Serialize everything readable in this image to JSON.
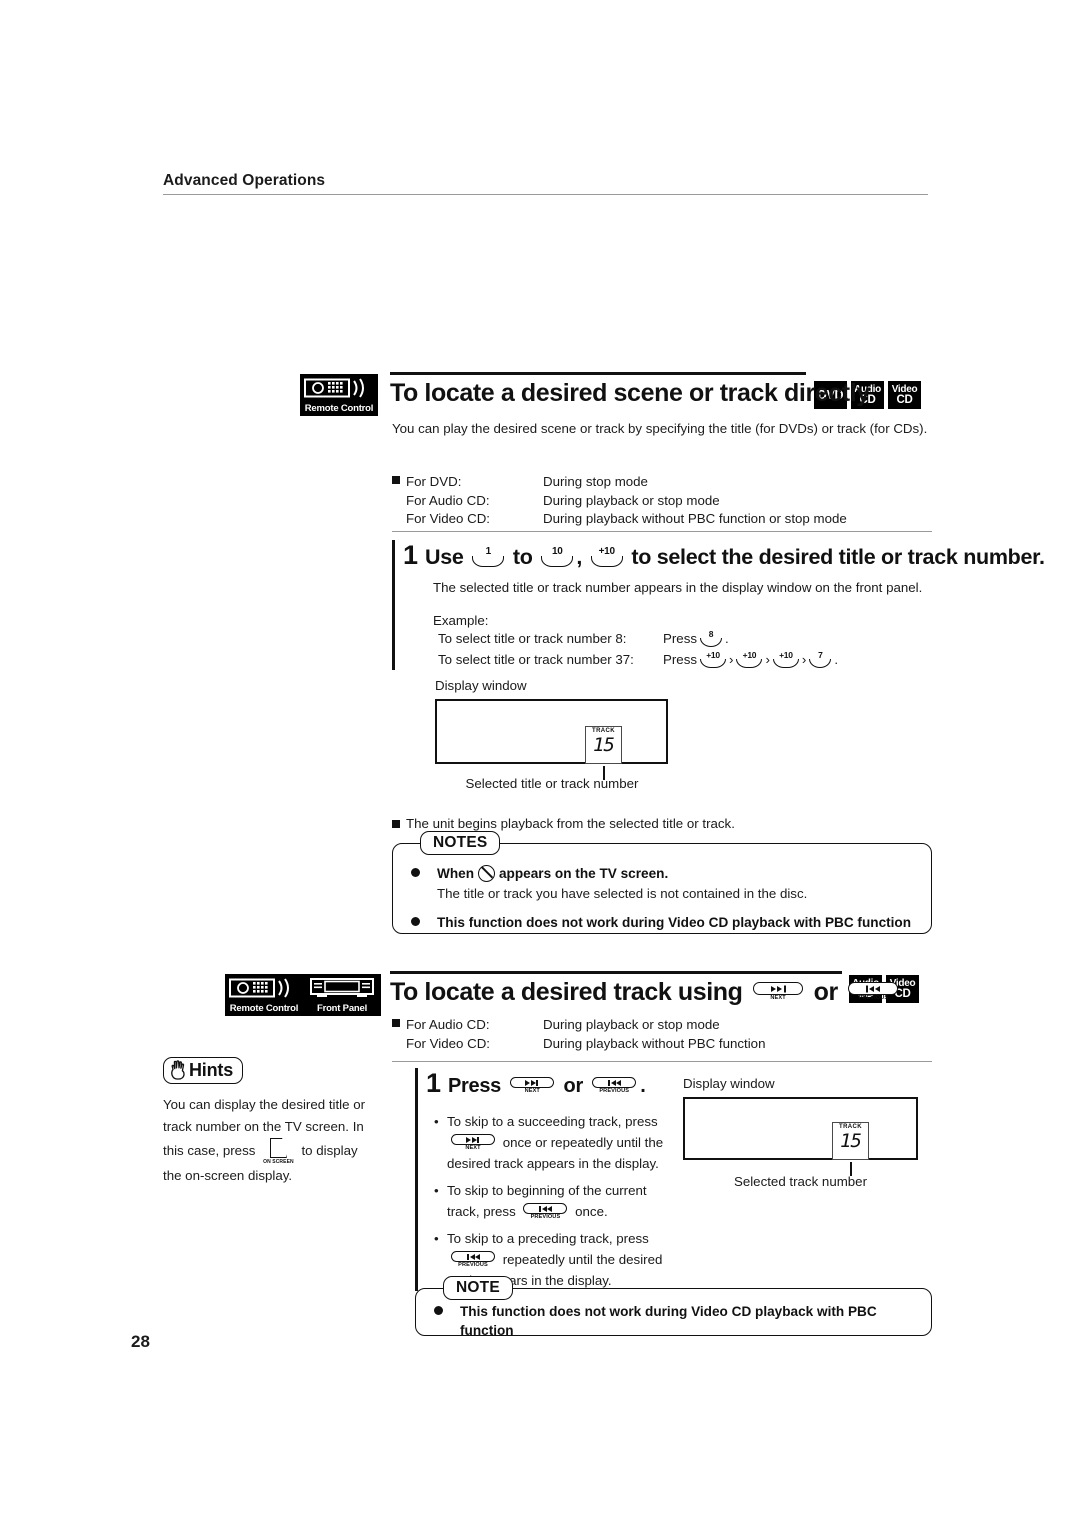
{
  "running_head": {
    "text": "Advanced Operations"
  },
  "page_number": "28",
  "section1": {
    "source_badge": {
      "label": "Remote Control",
      "icon": "remote-control-icon"
    },
    "title": "To locate a desired scene or track directly",
    "media_badges": [
      {
        "line1": "DVD",
        "line2": ""
      },
      {
        "line1": "Audio",
        "line2": "CD"
      },
      {
        "line1": "Video",
        "line2": "CD"
      }
    ],
    "intro": "You can play the desired scene or track by specifying the title (for DVDs) or track (for CDs).",
    "modes": [
      {
        "key": "For DVD:",
        "value": "During stop mode"
      },
      {
        "key": "For Audio CD:",
        "value": "During playback or stop mode"
      },
      {
        "key": "For Video CD:",
        "value": "During playback without PBC function or stop mode"
      }
    ],
    "step": {
      "number": "1",
      "title_before": "Use",
      "key_1": "1",
      "title_mid1": "to",
      "key_10": "10",
      "title_comma": ",",
      "key_plus10": "+10",
      "title_after": "to select the desired title or track number.",
      "description": "The selected title or track number appears in the display window on the front panel.",
      "example_label": "Example:",
      "examples": [
        {
          "description": "To select title or track number 8:",
          "press_label": "Press",
          "keys": [
            "8"
          ],
          "separators": [],
          "period": "."
        },
        {
          "description": "To select title or track number 37:",
          "press_label": "Press",
          "keys": [
            "+10",
            "+10",
            "+10",
            "7"
          ],
          "separators": [
            "›",
            "›",
            "›"
          ],
          "period": "."
        }
      ]
    },
    "display_figure": {
      "caption_top": "Display window",
      "track_label": "TRACK",
      "digits": "15",
      "caption_bottom": "Selected title or track number"
    },
    "outcome": "The unit begins playback from the selected title or track.",
    "notes": {
      "title": "NOTES",
      "items": [
        {
          "strong_before": "When",
          "icon": "prohibited-icon",
          "strong_after": "appears on the TV screen.",
          "sub": "The title or track you have selected is not contained in the disc."
        },
        {
          "strong_before": "This function does not work during Video CD playback with PBC function",
          "icon": "",
          "strong_after": "",
          "sub": ""
        }
      ]
    }
  },
  "section2": {
    "source_badges": [
      {
        "label": "Remote Control",
        "icon": "remote-control-icon"
      },
      {
        "label": "Front Panel",
        "icon": "front-panel-icon"
      }
    ],
    "title_before": "To locate a desired track using",
    "key_next": "NEXT",
    "title_or": "or",
    "key_previous": "PREVIOUS",
    "media_badges": [
      {
        "line1": "Audio",
        "line2": "CD"
      },
      {
        "line1": "Video",
        "line2": "CD"
      }
    ],
    "modes": [
      {
        "key": "For Audio CD:",
        "value": "During playback or stop mode"
      },
      {
        "key": "For Video CD:",
        "value": "During playback without PBC function"
      }
    ],
    "hints": {
      "title": "Hints",
      "icon": "pointing-hand-icon",
      "text_part1": "You can display the desired title or track number on the TV screen. In this case, press",
      "button_label": "ON SCREEN",
      "text_part2": "to display the on-screen display."
    },
    "step": {
      "number": "1",
      "title_before": "Press",
      "key_next": "NEXT",
      "title_or": "or",
      "key_previous": "PREVIOUS",
      "title_period": ".",
      "bullets": [
        {
          "part1": "To skip to a succeeding track, press",
          "key": "NEXT",
          "part2": "once or repeatedly until the desired track appears in the display."
        },
        {
          "part1": "To skip to beginning of the current track, press",
          "key": "PREVIOUS",
          "part2": "once."
        },
        {
          "part1": "To skip to a preceding track, press",
          "key": "PREVIOUS",
          "part2": "repeatedly until the desired track appears in the display."
        }
      ]
    },
    "display_figure": {
      "caption_top": "Display window",
      "track_label": "TRACK",
      "digits": "15",
      "caption_bottom": "Selected track number"
    },
    "note": {
      "title": "NOTE",
      "items": [
        {
          "text": "This function does not work during Video CD playback with PBC function"
        }
      ]
    }
  },
  "colors": {
    "ink": "#111111",
    "rule": "#9a9a9a",
    "badge_bg": "#000000",
    "paper": "#ffffff"
  }
}
